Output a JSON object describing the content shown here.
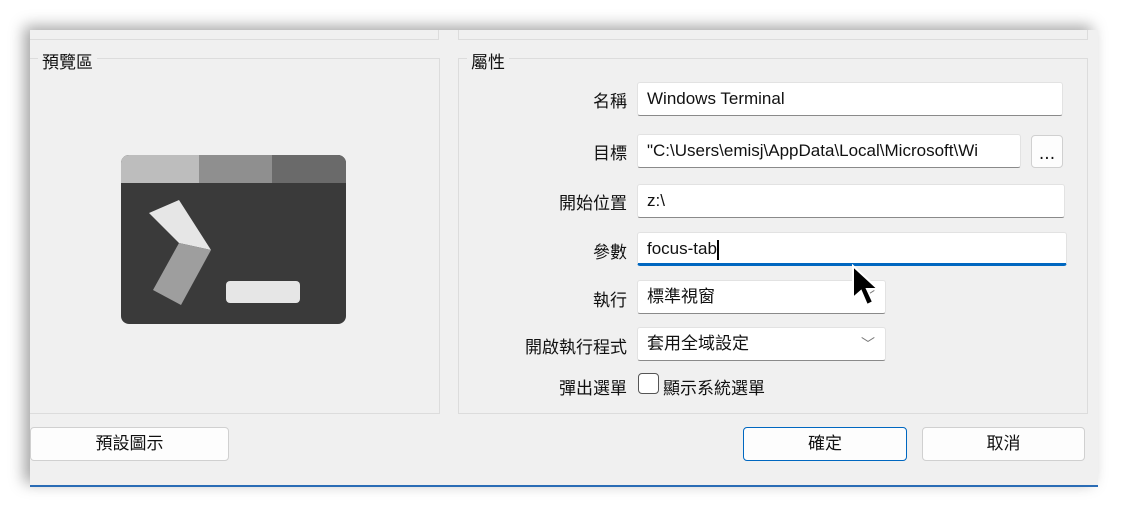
{
  "preview": {
    "title": "預覽區",
    "icon": "windows-terminal-icon"
  },
  "properties": {
    "title": "屬性",
    "name": {
      "label": "名稱",
      "value": "Windows Terminal"
    },
    "target": {
      "label": "目標",
      "value": "\"C:\\Users\\emisj\\AppData\\Local\\Microsoft\\Wi",
      "browse": "..."
    },
    "start_in": {
      "label": "開始位置",
      "value": "z:\\"
    },
    "args": {
      "label": "參數",
      "value": "focus-tab"
    },
    "run": {
      "label": "執行",
      "value": "標準視窗"
    },
    "open_with": {
      "label": "開啟執行程式",
      "value": "套用全域設定"
    },
    "popup": {
      "label": "彈出選單",
      "checkbox_label": "顯示系統選單",
      "checked": false
    }
  },
  "buttons": {
    "default_icon": "預設圖示",
    "ok": "確定",
    "cancel": "取消"
  },
  "colors": {
    "accent": "#0067c0"
  }
}
